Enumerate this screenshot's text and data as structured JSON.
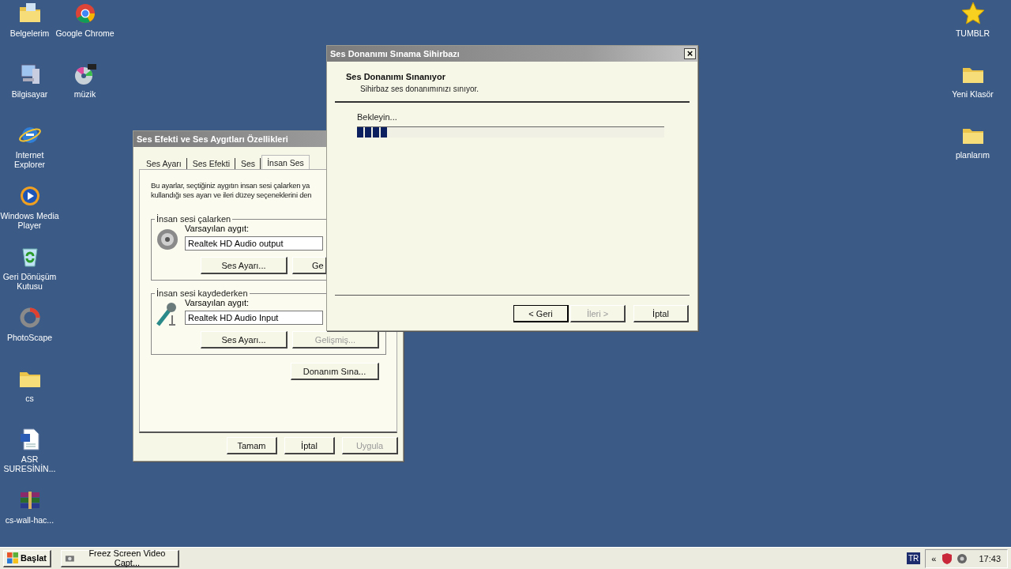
{
  "desktop": {
    "column_1": [
      {
        "label": "Belgelerim",
        "kind": "documents"
      },
      {
        "label": "Bilgisayar",
        "kind": "computer"
      },
      {
        "label": "Internet Explorer",
        "kind": "browser-e"
      },
      {
        "label": "Windows Media Player",
        "kind": "player"
      },
      {
        "label": "Geri Dönüşüm Kutusu",
        "kind": "recycle"
      },
      {
        "label": "PhotoScape",
        "kind": "ring"
      },
      {
        "label": "cs",
        "kind": "folder"
      },
      {
        "label": "ASR SURESİNİN...",
        "kind": "word"
      },
      {
        "label": "cs-wall-hac...",
        "kind": "archive"
      }
    ],
    "column_2": [
      {
        "label": "Google Chrome",
        "kind": "chrome"
      },
      {
        "label": "müzik",
        "kind": "cd"
      }
    ],
    "right_column": [
      {
        "label": "TUMBLR",
        "kind": "star"
      },
      {
        "label": "Yeni Klasör",
        "kind": "folder"
      },
      {
        "label": "planlarım",
        "kind": "folder"
      }
    ]
  },
  "properties_dialog": {
    "title": "Ses Efekti ve Ses Aygıtları Özellikleri",
    "tabs": [
      {
        "label": "Ses Ayarı",
        "selected": false
      },
      {
        "label": "Ses Efekti",
        "selected": false
      },
      {
        "label": "Ses",
        "selected": false
      },
      {
        "label": "İnsan Ses",
        "selected": true
      }
    ],
    "description": [
      "Bu ayarlar, seçtiğiniz aygıtın insan sesi çalarken ya",
      "kullandığı ses ayarı ve ileri düzey seçeneklerini den"
    ],
    "groups": [
      {
        "title": "İnsan sesi çalarken",
        "kind": "speaker",
        "device_label": "Varsayılan aygıt:",
        "device": "Realtek HD Audio output",
        "buttons": [
          {
            "label": "Ses Ayarı...",
            "disabled": false
          },
          {
            "label": "Ge",
            "disabled": false
          }
        ]
      },
      {
        "title": "İnsan sesi kaydederken",
        "kind": "microphone",
        "device_label": "Varsayılan aygıt:",
        "device": "Realtek HD Audio Input",
        "buttons": [
          {
            "label": "Ses Ayarı...",
            "disabled": false
          },
          {
            "label": "Gelişmiş...",
            "disabled": true
          }
        ]
      }
    ],
    "test_button": "Donanım Sına...",
    "buttons": [
      {
        "label": "Tamam",
        "disabled": false
      },
      {
        "label": "İptal",
        "disabled": false
      },
      {
        "label": "Uygula",
        "disabled": true
      }
    ]
  },
  "wizard": {
    "title": "Ses Donanımı Sınama Sihirbazı",
    "close": "×",
    "heading": "Ses Donanımı Sınanıyor",
    "subtitle": "Sihirbaz ses donanımınızı sınıyor.",
    "status": "Bekleyin...",
    "progress": {
      "level": 0.1
    },
    "buttons": [
      {
        "label": "< Geri",
        "disabled": false,
        "default": true
      },
      {
        "label": "İleri >",
        "disabled": true,
        "default": false
      },
      {
        "label": "İptal",
        "disabled": false,
        "default": false
      }
    ]
  },
  "taskbar": {
    "start": "Başlat",
    "tasks": [
      {
        "label": "Freez Screen Video Capt...",
        "selected": false
      }
    ],
    "language": "TR",
    "tray_expand": "«",
    "clock": "17:43"
  }
}
